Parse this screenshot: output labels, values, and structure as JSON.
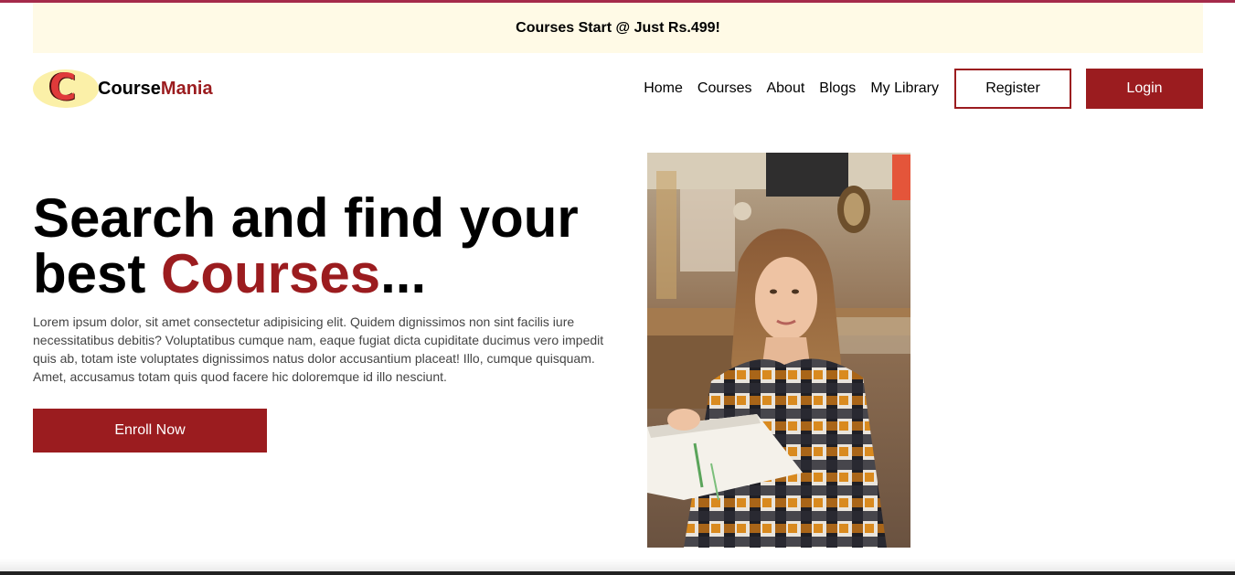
{
  "announcement": {
    "text": "Courses Start @ Just Rs.499!"
  },
  "brand": {
    "logo_letter": "C",
    "name_part1": "Course",
    "name_part2": "Mania",
    "accent_color": "#9b1c1f",
    "logo_bg_color": "#fbf0a8"
  },
  "nav": {
    "links": [
      {
        "label": "Home"
      },
      {
        "label": "Courses"
      },
      {
        "label": "About"
      },
      {
        "label": "Blogs"
      },
      {
        "label": "My Library"
      }
    ],
    "register_label": "Register",
    "login_label": "Login"
  },
  "hero": {
    "title_part1": "Search and find your best ",
    "title_highlight": "Courses",
    "title_part2": "...",
    "description": "Lorem ipsum dolor, sit amet consectetur adipisicing elit. Quidem dignissimos non sint facilis iure necessitatibus debitis? Voluptatibus cumque nam, eaque fugiat dicta cupiditate ducimus vero impedit quis ab, totam iste voluptates dignissimos natus dolor accusantium placeat! Illo, cumque quisquam. Amet, accusamus totam quis quod facere hic doloremque id illo nesciunt.",
    "enroll_label": "Enroll Now",
    "image_subject": "student-reading-photo"
  }
}
